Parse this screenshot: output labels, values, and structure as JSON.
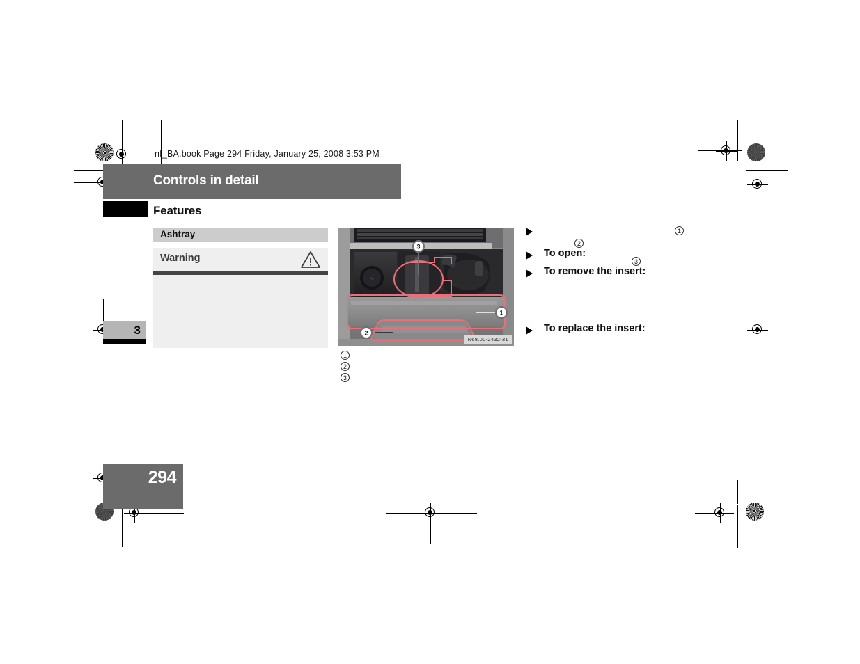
{
  "document": {
    "file_stamp": "nf_BA.book  Page 294  Friday, January 25, 2008  3:53 PM",
    "chapter_header": "Controls in detail",
    "section_title": "Features",
    "chapter_tab_number": "3",
    "page_number": "294"
  },
  "panel": {
    "heading": "Ashtray",
    "warning_label": "Warning",
    "warning_icon": "warning-triangle-icon",
    "warning_body": ""
  },
  "figure": {
    "code": "N68.00-2432-31",
    "callouts": [
      {
        "number": "3",
        "label": ""
      },
      {
        "number": "1",
        "label": ""
      },
      {
        "number": "2",
        "label": ""
      }
    ]
  },
  "legend": [
    {
      "number": "1",
      "label": ""
    },
    {
      "number": "2",
      "label": ""
    },
    {
      "number": "3",
      "label": ""
    }
  ],
  "instructions": [
    {
      "marker": "triangle-bullet",
      "label": ""
    },
    {
      "marker": "triangle-bullet",
      "label": "To open:"
    },
    {
      "marker": "triangle-bullet",
      "label": "To remove the insert:"
    },
    {
      "marker": "triangle-bullet",
      "label": "To replace the insert:"
    }
  ],
  "inline_numbers": [
    {
      "number": "1"
    },
    {
      "number": "2"
    },
    {
      "number": "3"
    }
  ],
  "colors": {
    "header_band": "#6b6b6b",
    "panel_heading": "#cccccc",
    "warning_box": "#efefef",
    "warning_rule": "#454545",
    "black_tab": "#000000",
    "chapter_tab": "#b5b5b5",
    "page_block": "#6b6b6b",
    "callout_outline": "#e8707a"
  }
}
